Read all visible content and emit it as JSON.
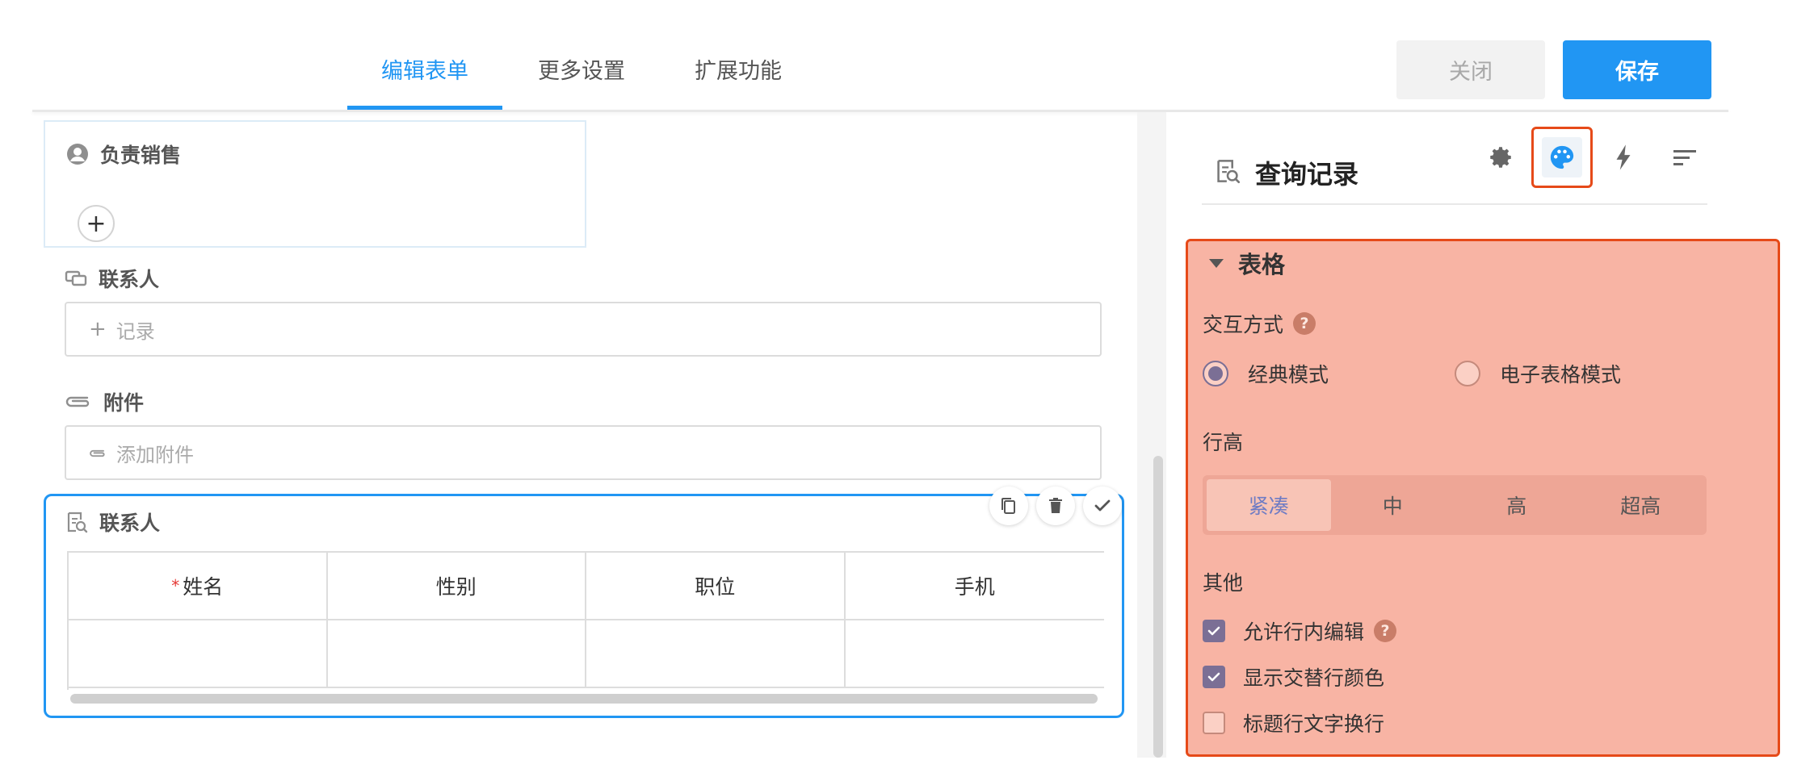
{
  "header": {
    "tabs": [
      {
        "label": "编辑表单",
        "active": true
      },
      {
        "label": "更多设置",
        "active": false
      },
      {
        "label": "扩展功能",
        "active": false
      }
    ],
    "close_label": "关闭",
    "save_label": "保存"
  },
  "form": {
    "sales_owner": {
      "label": "负责销售",
      "add_symbol": "+"
    },
    "contact_field": {
      "label": "联系人",
      "placeholder": "记录",
      "prefix": "+"
    },
    "attachment_field": {
      "label": "附件",
      "placeholder": "添加附件"
    },
    "subtable": {
      "label": "联系人",
      "columns": [
        {
          "label": "姓名",
          "required": true,
          "required_mark": "*"
        },
        {
          "label": "性别",
          "required": false
        },
        {
          "label": "职位",
          "required": false
        },
        {
          "label": "手机",
          "required": false
        }
      ],
      "actions": [
        "copy-icon",
        "delete-icon",
        "check-icon"
      ]
    }
  },
  "panel": {
    "title": "查询记录",
    "icons": [
      "gear-icon",
      "palette-icon",
      "lightning-icon",
      "sort-icon"
    ],
    "selected_icon": "palette-icon",
    "section_title": "表格",
    "interaction": {
      "label": "交互方式",
      "help": "?",
      "options": [
        {
          "label": "经典模式",
          "selected": true
        },
        {
          "label": "电子表格模式",
          "selected": false
        }
      ]
    },
    "row_height": {
      "label": "行高",
      "options": [
        "紧凑",
        "中",
        "高",
        "超高"
      ],
      "selected": "紧凑"
    },
    "other": {
      "label": "其他",
      "help": "?",
      "checkboxes": [
        {
          "label": "允许行内编辑",
          "checked": true,
          "has_help": true
        },
        {
          "label": "显示交替行颜色",
          "checked": true,
          "has_help": false
        },
        {
          "label": "标题行文字换行",
          "checked": false,
          "has_help": false
        }
      ]
    }
  },
  "colors": {
    "accent": "#2196f3",
    "highlight_fill": "#f8b4a4",
    "highlight_border": "#e64a19"
  }
}
